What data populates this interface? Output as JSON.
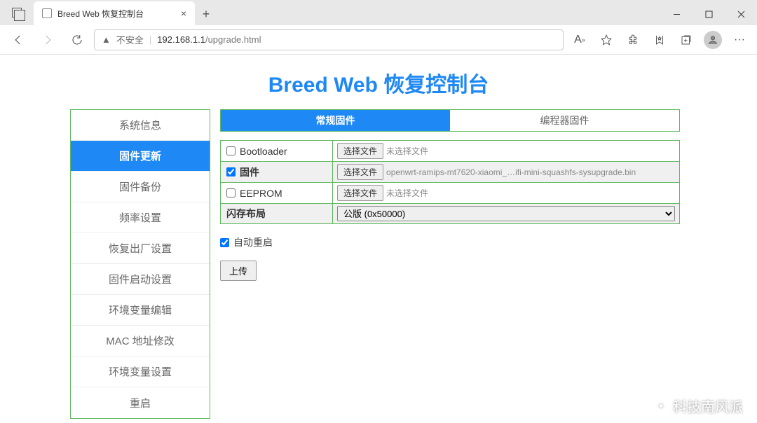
{
  "browser": {
    "tab_title": "Breed Web 恢复控制台",
    "insecure_label": "不安全",
    "url_host": "192.168.1.1",
    "url_path": "/upgrade.html"
  },
  "page": {
    "title": "Breed Web 恢复控制台"
  },
  "sidebar": {
    "items": [
      "系统信息",
      "固件更新",
      "固件备份",
      "频率设置",
      "恢复出厂设置",
      "固件启动设置",
      "环境变量编辑",
      "MAC 地址修改",
      "环境变量设置",
      "重启"
    ],
    "active_index": 1
  },
  "tabs": {
    "items": [
      "常规固件",
      "编程器固件"
    ],
    "active_index": 0
  },
  "form": {
    "rows": [
      {
        "label": "Bootloader",
        "checked": false,
        "btn": "选择文件",
        "status": "未选择文件"
      },
      {
        "label": "固件",
        "checked": true,
        "btn": "选择文件",
        "status": "openwrt-ramips-mt7620-xiaomi_…ifi-mini-squashfs-sysupgrade.bin"
      },
      {
        "label": "EEPROM",
        "checked": false,
        "btn": "选择文件",
        "status": "未选择文件"
      }
    ],
    "flash_layout_label": "闪存布局",
    "flash_layout_value": "公版 (0x50000)",
    "auto_reboot_label": "自动重启",
    "auto_reboot_checked": true,
    "upload_label": "上传"
  },
  "watermark": "科技南风派"
}
